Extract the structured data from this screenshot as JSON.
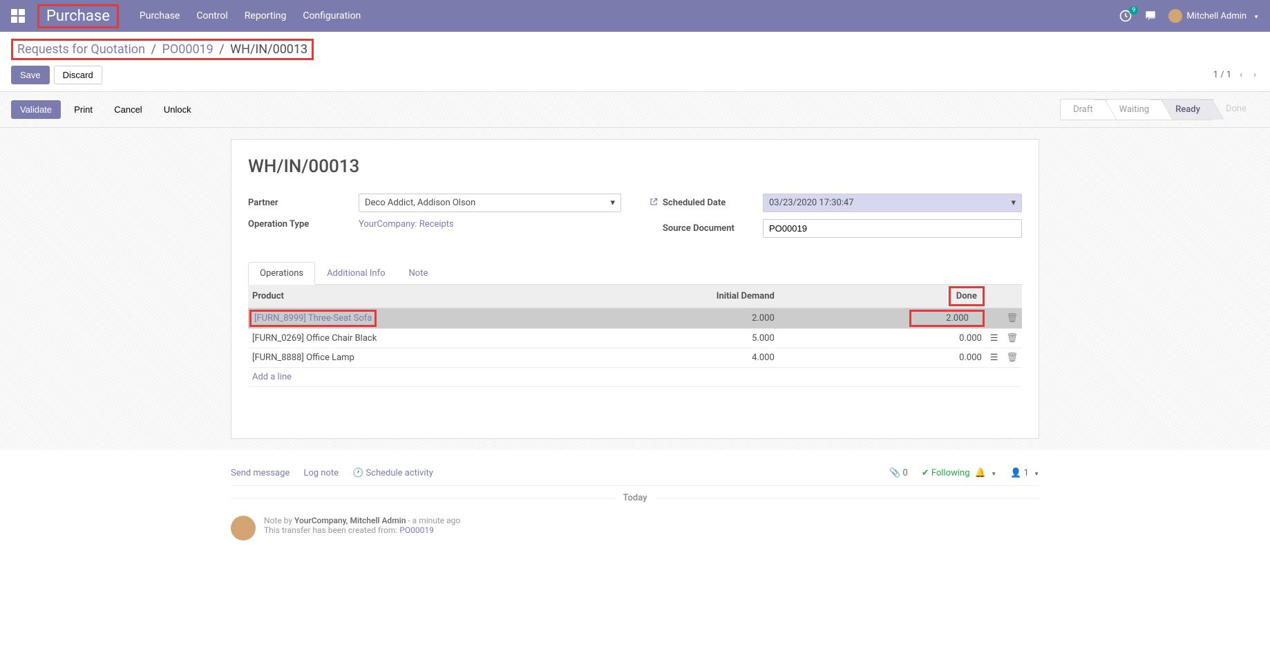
{
  "nav": {
    "brand": "Purchase",
    "links": [
      "Purchase",
      "Control",
      "Reporting",
      "Configuration"
    ],
    "notif_count": "9",
    "user": "Mitchell Admin"
  },
  "breadcrumb": {
    "parts": [
      "Requests for Quotation",
      "PO00019",
      "WH/IN/00013"
    ]
  },
  "buttons": {
    "save": "Save",
    "discard": "Discard",
    "validate": "Validate",
    "print": "Print",
    "cancel": "Cancel",
    "unlock": "Unlock"
  },
  "pager": {
    "text": "1 / 1"
  },
  "status": {
    "steps": [
      "Draft",
      "Waiting",
      "Ready",
      "Done"
    ],
    "active": "Ready"
  },
  "form": {
    "title": "WH/IN/00013",
    "partner_label": "Partner",
    "partner_value": "Deco Addict, Addison Olson",
    "operation_type_label": "Operation Type",
    "operation_type_value": "YourCompany: Receipts",
    "scheduled_date_label": "Scheduled Date",
    "scheduled_date_value": "03/23/2020 17:30:47",
    "source_doc_label": "Source Document",
    "source_doc_value": "PO00019"
  },
  "tabs": {
    "operations": "Operations",
    "additional": "Additional Info",
    "note": "Note"
  },
  "table": {
    "headers": {
      "product": "Product",
      "initial_demand": "Initial Demand",
      "done": "Done"
    },
    "rows": [
      {
        "product": "[FURN_8999] Three-Seat Sofa",
        "demand": "2.000",
        "done": "2.000",
        "selected": true,
        "has_list": false
      },
      {
        "product": "[FURN_0269] Office Chair Black",
        "demand": "5.000",
        "done": "0.000",
        "selected": false,
        "has_list": true
      },
      {
        "product": "[FURN_8888] Office Lamp",
        "demand": "4.000",
        "done": "0.000",
        "selected": false,
        "has_list": true
      }
    ],
    "add_line": "Add a line"
  },
  "chatter": {
    "send_message": "Send message",
    "log_note": "Log note",
    "schedule_activity": "Schedule activity",
    "attachments": "0",
    "following": "Following",
    "followers": "1",
    "today": "Today",
    "note_prefix": "Note by",
    "note_author": "YourCompany, Mitchell Admin",
    "note_time": "- a minute ago",
    "note_body": "This transfer has been created from:",
    "note_link": "PO00019"
  }
}
